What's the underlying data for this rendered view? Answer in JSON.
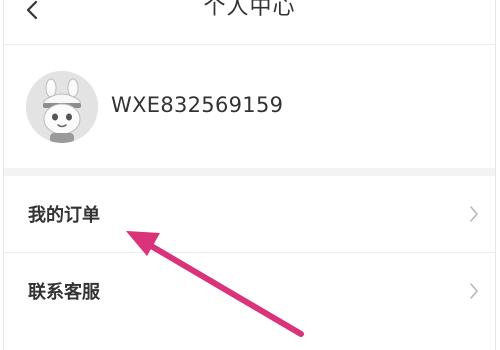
{
  "header": {
    "title": "个人中心",
    "back_icon": "chevron-left-icon"
  },
  "profile": {
    "username": "WXE832569159",
    "avatar_icon": "robot-avatar-icon"
  },
  "menu": {
    "items": [
      {
        "label": "我的订单",
        "icon": "chevron-right-icon"
      },
      {
        "label": "联系客服",
        "icon": "chevron-right-icon"
      }
    ]
  },
  "annotation": {
    "color": "#d9337a",
    "icon": "pink-arrow-icon"
  }
}
